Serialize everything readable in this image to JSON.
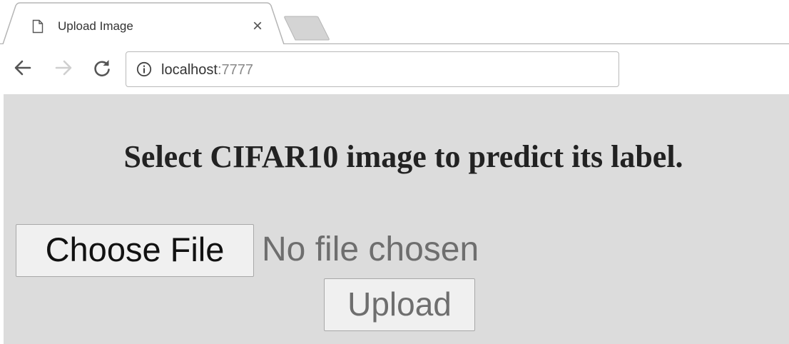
{
  "browser": {
    "tab": {
      "title": "Upload Image",
      "close_glyph": "×",
      "icon": "page-icon"
    },
    "toolbar": {
      "back_icon": "back-arrow-icon",
      "forward_icon": "forward-arrow-icon",
      "reload_icon": "reload-icon"
    },
    "address_bar": {
      "info_icon": "info-icon",
      "host": "localhost",
      "port": ":7777"
    }
  },
  "page": {
    "heading": "Select CIFAR10 image to predict its label.",
    "file_input": {
      "button_label": "Choose File",
      "status_text": "No file chosen"
    },
    "upload_button_label": "Upload"
  },
  "colors": {
    "page_background": "#dcdcdc",
    "tab_border": "#b5b5b5",
    "new_tab_fill": "#d4d4d4"
  }
}
